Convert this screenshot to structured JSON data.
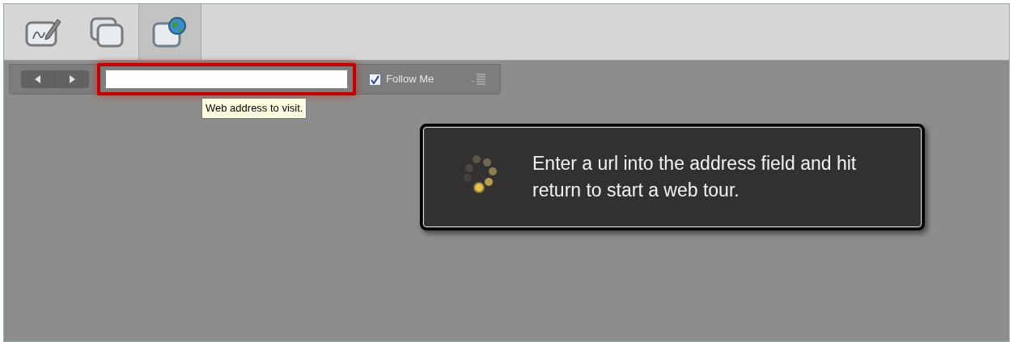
{
  "tabs": [
    {
      "kind": "draw",
      "selected": false
    },
    {
      "kind": "screens",
      "selected": false
    },
    {
      "kind": "web",
      "selected": true
    }
  ],
  "toolbar": {
    "address_field": {
      "focused": true
    },
    "follow_me": {
      "label": "Follow Me",
      "checked": true
    }
  },
  "tooltip": "Web address to visit.",
  "message": "Enter a url into the address field and hit return to start a web tour."
}
